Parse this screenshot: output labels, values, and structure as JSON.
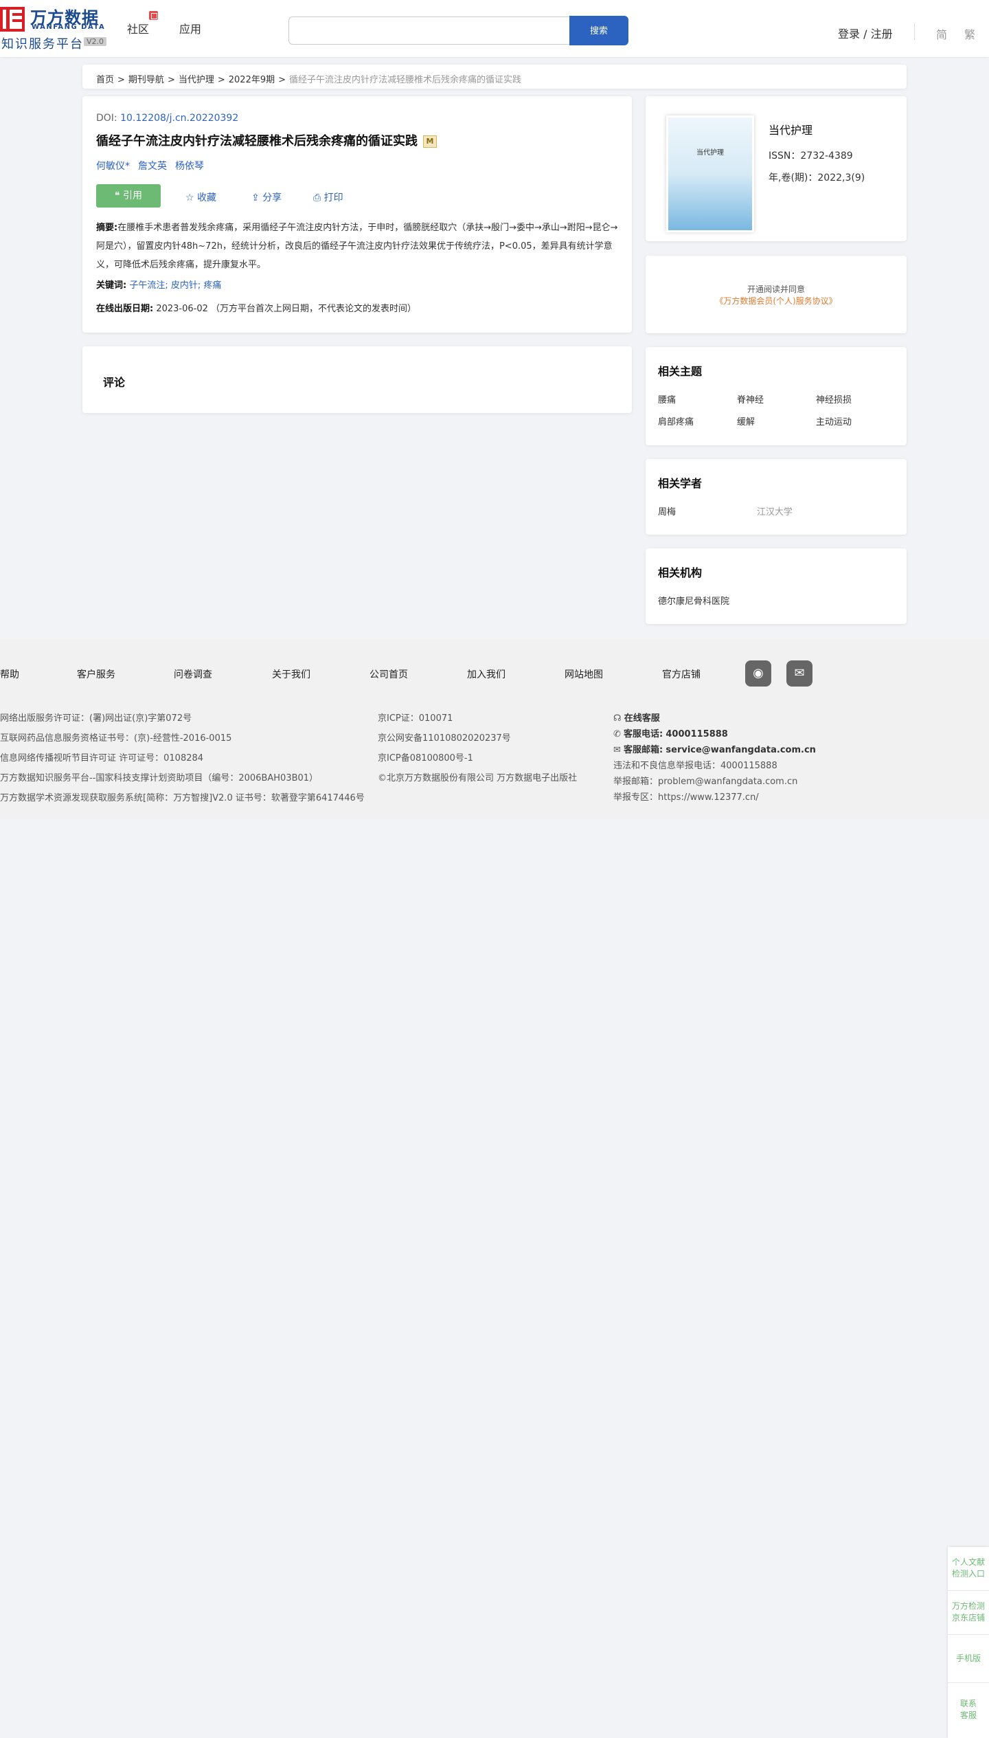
{
  "header": {
    "logo_cn": "万方数据",
    "logo_en": "WANFANG DATA",
    "logo_sub": "知识服务平台",
    "logo_version": "V2.0",
    "nav": [
      "社区",
      "应用"
    ],
    "search_placeholder": "",
    "search_button": "搜索",
    "login": "登录 / 注册",
    "lang_simplified": "简",
    "lang_traditional": "繁"
  },
  "breadcrumb": {
    "items": [
      "首页",
      "期刊导航",
      "当代护理",
      "2022年9期"
    ],
    "sep": ">",
    "current": "循经子午流注皮内针疗法减轻腰椎术后残余疼痛的循证实践"
  },
  "article": {
    "doi_label": "DOI:",
    "doi": "10.12208/j.cn.20220392",
    "title": "循经子午流注皮内针疗法减轻腰椎术后残余疼痛的循证实践",
    "title_badge": "M",
    "authors": [
      "何敏仪*",
      "詹文英",
      "杨依琴"
    ],
    "actions": {
      "cite": "❝ 引用",
      "collect": "收藏",
      "share": "分享",
      "print": "打印"
    },
    "abstract_label": "摘要:",
    "abstract_text": "在腰椎手术患者普发残余疼痛，采用循经子午流注皮内针方法，于申时，循膀胱经取穴（承扶→殷门→委中→承山→跗阳→昆仑→阿是穴），留置皮内针48h~72h，经统计分析，改良后的循经子午流注皮内针疗法效果优于传统疗法，P<0.05，差异具有统计学意义，可降低术后残余疼痛，提升康复水平。",
    "keywords_label": "关键词:",
    "keywords": [
      "子午流注;",
      "皮内针;",
      "疼痛"
    ],
    "pub_label": "在线出版日期:",
    "pub_date": "2023-06-02",
    "pub_note": "（万方平台首次上网日期，不代表论文的发表时间）"
  },
  "comments": {
    "title": "评论"
  },
  "journal": {
    "cover_title": "当代护理",
    "name": "当代护理",
    "issn": "ISSN：2732-4389",
    "volume": "年,卷(期)：2022,3(9)"
  },
  "notice": {
    "line1": "开通阅读并同意",
    "line2": "《万方数据会员(个人)服务协议》"
  },
  "related_topics": {
    "title": "相关主题",
    "items": [
      "腰痛",
      "脊神经",
      "神经损损",
      "肩部疼痛",
      "缓解",
      "主动运动"
    ]
  },
  "related_scholars": {
    "title": "相关学者",
    "name": "周梅",
    "affiliation": "江汉大学"
  },
  "related_orgs": {
    "title": "相关机构",
    "name": "德尔康尼骨科医院"
  },
  "footer": {
    "nav": [
      "帮助",
      "客户服务",
      "问卷调查",
      "关于我们",
      "公司首页",
      "加入我们",
      "网站地图",
      "官方店铺"
    ],
    "col1": [
      "网络出版服务许可证：(署)网出证(京)字第072号",
      "互联网药品信息服务资格证书号：(京)-经营性-2016-0015",
      "信息网络传播视听节目许可证 许可证号：0108284",
      "万方数据知识服务平台--国家科技支撑计划资助项目（编号：2006BAH03B01）",
      "万方数据学术资源发现获取服务系统[简称：万方智搜]V2.0 证书号：软著登字第6417446号"
    ],
    "col2": [
      "京ICP证：010071",
      "京公网安备11010802020237号",
      "京ICP备08100800号-1",
      "©北京万方数据股份有限公司 万方数据电子出版社"
    ],
    "online_service": "在线客服",
    "phone_label": "客服电话:",
    "phone": "4000115888",
    "email_label": "客服邮箱:",
    "email": "service@wanfangdata.com.cn",
    "report_phone": "违法和不良信息举报电话：4000115888",
    "report_email": "举报邮箱：problem@wanfangdata.com.cn",
    "report_zone": "举报专区：https://www.12377.cn/"
  },
  "side_float": {
    "items": [
      "个人文献\n检测入口",
      "万方检测\n京东店铺",
      "手机版",
      "联系\n客服"
    ]
  }
}
